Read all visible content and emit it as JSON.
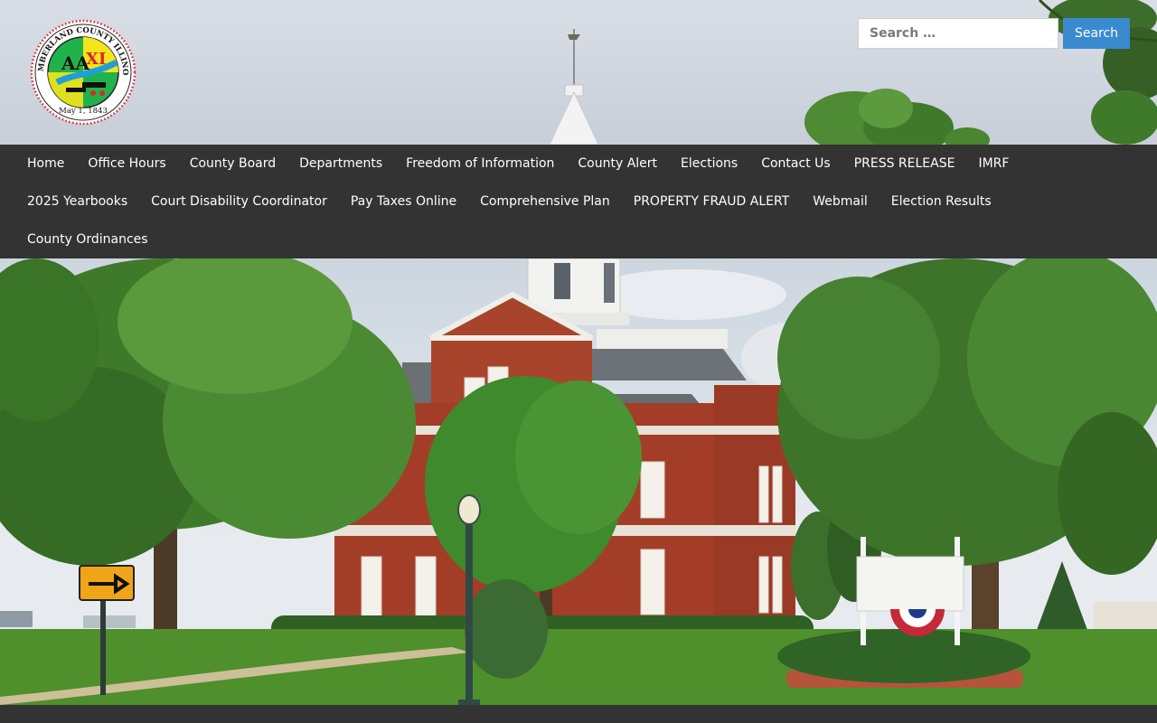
{
  "logo": {
    "arc_text": "CUMBERLAND COUNTY ILLINOIS",
    "date_text": "May 1, 1843",
    "colors": {
      "ring": "#e0242a",
      "green": "#22b24c",
      "yellow": "#f4e41c",
      "red": "#e0242a"
    }
  },
  "search": {
    "placeholder": "Search …",
    "button_label": "Search",
    "accent": "#3a8ad0"
  },
  "nav": {
    "rows": [
      [
        "Home",
        "Office Hours",
        "County Board",
        "Departments",
        "Freedom of Information",
        "County Alert",
        "Elections",
        "Contact Us",
        "PRESS RELEASE",
        "IMRF"
      ],
      [
        "2025 Yearbooks",
        "Court Disability Coordinator",
        "Pay Taxes Online",
        "Comprehensive Plan",
        "PROPERTY FRAUD ALERT",
        "Webmail",
        "Election Results"
      ],
      [
        "County Ordinances"
      ]
    ],
    "background": "#333333"
  },
  "hero": {
    "icons": [
      "arrow-right-sign-icon",
      "lamp-post-icon"
    ],
    "colors": {
      "brick": "#a43d28",
      "roof": "#6b7075",
      "tree": "#3f7a2a",
      "grass": "#4f8f2c"
    }
  }
}
